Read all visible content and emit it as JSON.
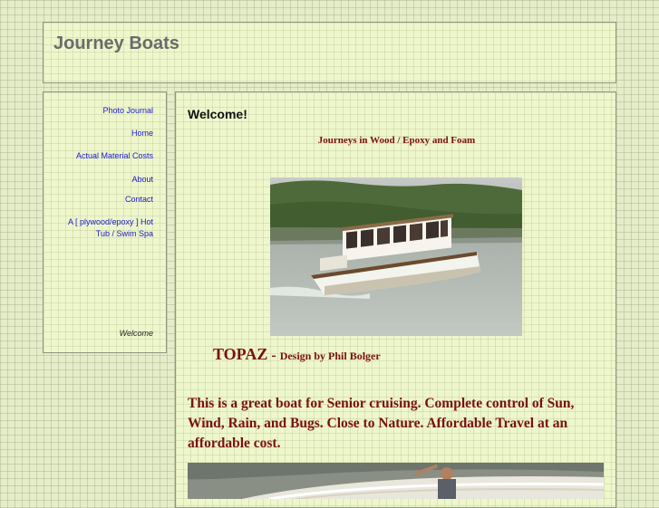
{
  "header": {
    "site_title": "Journey Boats"
  },
  "sidebar": {
    "items": [
      {
        "label": "Photo Journal"
      },
      {
        "label": "Home"
      },
      {
        "label": "Actual Material Costs"
      },
      {
        "label": "About"
      },
      {
        "label": "Contact"
      },
      {
        "label": "A [ plywood/epoxy ] Hot Tub / Swim Spa"
      },
      {
        "label": "Welcome",
        "current": true
      }
    ]
  },
  "main": {
    "heading": "Welcome!",
    "tagline": "Journeys in Wood / Epoxy  and Foam",
    "boat_name": "TOPAZ",
    "boat_separator": " - ",
    "boat_designer": "Design by Phil Bolger",
    "description": "This is a great boat for Senior cruising. Complete control of Sun, Wind, Rain, and Bugs. Close to Nature. Affordable Travel at an affordable cost."
  },
  "colors": {
    "page_background": "#e4ecc8",
    "panel_background": "#eef6cc",
    "link": "#1a1acc",
    "accent_text": "#7a1010"
  }
}
